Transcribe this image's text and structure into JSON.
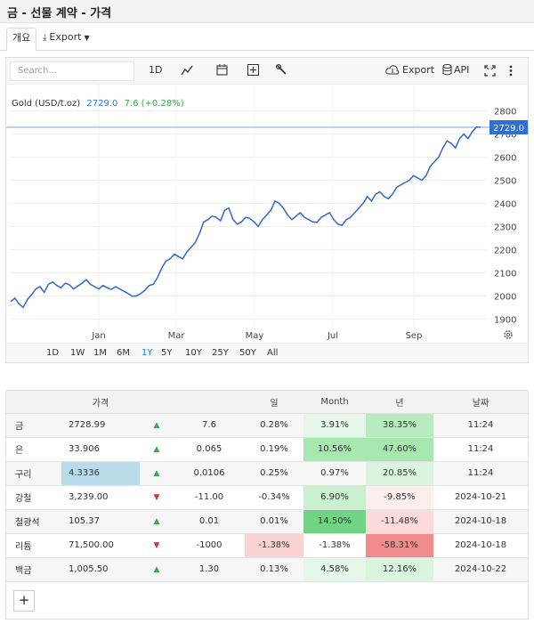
{
  "page_title": "금 - 선물 계약 - 가격",
  "tabs": {
    "overview": "개요",
    "export": "Export"
  },
  "toolbar": {
    "search_placeholder": "Search...",
    "interval": "1D",
    "export_label": "Export",
    "api_label": "API"
  },
  "chart_label": {
    "name": "Gold (USD/t.oz)",
    "price": "2729.0",
    "change": "7.6 (+0.28%)"
  },
  "ranges": [
    "1D",
    "1W",
    "1M",
    "6M",
    "1Y",
    "5Y",
    "10Y",
    "25Y",
    "50Y",
    "All"
  ],
  "active_range": "1Y",
  "colors": {
    "line": "#3366cc",
    "accent": "#2e7bd6",
    "up": "#3aa64a",
    "down": "#d0362e"
  },
  "chart_data": {
    "type": "line",
    "title": "Gold (USD/t.oz)",
    "x_ticks": [
      "Jan",
      "Mar",
      "May",
      "Jul",
      "Sep"
    ],
    "y_ticks": [
      1900,
      2000,
      2100,
      2200,
      2300,
      2400,
      2500,
      2600,
      2700,
      2800
    ],
    "ylim": [
      1830,
      2810
    ],
    "last_value": 2729.0,
    "series": [
      {
        "values": [
          1975,
          1990,
          1965,
          1950,
          1985,
          2005,
          2030,
          2040,
          2015,
          2050,
          2060,
          2045,
          2035,
          2055,
          2048,
          2030,
          2042,
          2055,
          2070,
          2050,
          2040,
          2030,
          2045,
          2035,
          2028,
          2040,
          2030,
          2020,
          2010,
          1998,
          2000,
          2010,
          2025,
          2045,
          2050,
          2080,
          2120,
          2150,
          2160,
          2180,
          2170,
          2160,
          2190,
          2210,
          2230,
          2270,
          2320,
          2330,
          2345,
          2340,
          2325,
          2370,
          2380,
          2330,
          2310,
          2320,
          2340,
          2335,
          2320,
          2300,
          2330,
          2350,
          2370,
          2410,
          2400,
          2380,
          2350,
          2330,
          2345,
          2360,
          2340,
          2330,
          2320,
          2318,
          2340,
          2350,
          2360,
          2330,
          2310,
          2305,
          2330,
          2340,
          2360,
          2380,
          2400,
          2430,
          2410,
          2440,
          2450,
          2430,
          2420,
          2440,
          2470,
          2480,
          2490,
          2500,
          2520,
          2510,
          2500,
          2520,
          2560,
          2580,
          2600,
          2640,
          2670,
          2660,
          2640,
          2680,
          2700,
          2680,
          2710,
          2730,
          2729
        ]
      }
    ]
  },
  "table": {
    "headers": [
      "",
      "가격",
      "",
      "",
      "일",
      "Month",
      "년",
      "날짜"
    ],
    "rows": [
      {
        "name": "금",
        "price": "2728.99",
        "dir": "up",
        "change": "7.6",
        "day": "0.28%",
        "month": "3.91%",
        "year": "38.35%",
        "date": "11:24"
      },
      {
        "name": "은",
        "price": "33.906",
        "dir": "up",
        "change": "0.065",
        "day": "0.19%",
        "month": "10.56%",
        "year": "47.60%",
        "date": "11:24"
      },
      {
        "name": "구리",
        "price": "4.3336",
        "dir": "up",
        "change": "0.0106",
        "day": "0.25%",
        "month": "0.97%",
        "year": "20.85%",
        "date": "11:24"
      },
      {
        "name": "강철",
        "price": "3,239.00",
        "dir": "down",
        "change": "-11.00",
        "day": "-0.34%",
        "month": "6.90%",
        "year": "-9.85%",
        "date": "2024-10-21"
      },
      {
        "name": "철광석",
        "price": "105.37",
        "dir": "up",
        "change": "0.01",
        "day": "0.01%",
        "month": "14.50%",
        "year": "-11.48%",
        "date": "2024-10-18"
      },
      {
        "name": "리튬",
        "price": "71,500.00",
        "dir": "down",
        "change": "-1000",
        "day": "-1.38%",
        "month": "-1.38%",
        "year": "-58.31%",
        "date": "2024-10-18"
      },
      {
        "name": "백금",
        "price": "1,005.50",
        "dir": "up",
        "change": "1.30",
        "day": "0.13%",
        "month": "4.58%",
        "year": "12.16%",
        "date": "2024-10-22"
      }
    ],
    "add_label": "+"
  }
}
